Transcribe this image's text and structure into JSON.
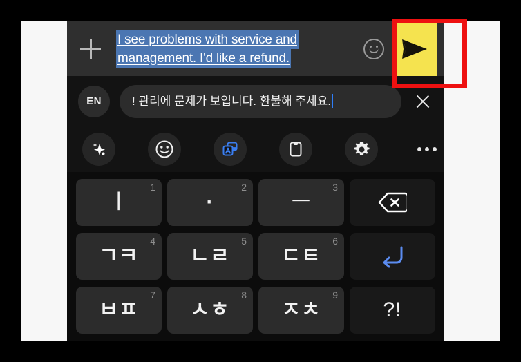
{
  "compose": {
    "add_icon": "plus-icon",
    "message_lines": [
      "I see problems with service and",
      "management. I'd like a refund."
    ],
    "message_full": "I see problems with service and management. I'd like a refund.",
    "selected": "true",
    "emoji_icon": "smiley-icon",
    "send_icon": "send-icon",
    "send_label": "Send",
    "send_highlight_color": "#f5e34f",
    "selection_color": "#4b76b2"
  },
  "annotation": {
    "shape": "rectangle",
    "color": "#ee1111",
    "target": "send-button"
  },
  "translate": {
    "language_badge": "EN",
    "source_text": "! 관리에 문제가 보입니다. 환불해 주세요.",
    "caret_color": "#2f7df6",
    "close_icon": "close-icon"
  },
  "toolbar": {
    "items": [
      {
        "name": "ai-sparkle-icon",
        "label": "AI suggestions",
        "active": "false"
      },
      {
        "name": "emoji-icon",
        "label": "Emoji",
        "active": "false"
      },
      {
        "name": "translate-icon",
        "label": "Translate",
        "active": "true"
      },
      {
        "name": "clipboard-icon",
        "label": "Clipboard",
        "active": "false"
      },
      {
        "name": "settings-gear-icon",
        "label": "Settings",
        "active": "false"
      },
      {
        "name": "more-options-icon",
        "label": "More options",
        "active": "false"
      }
    ],
    "active_color": "#3b7ef0"
  },
  "keyboard": {
    "layout": "cheonjiin",
    "rows": [
      [
        {
          "main": "ㅣ",
          "num": "1",
          "type": "char"
        },
        {
          "main": "·",
          "num": "2",
          "type": "char"
        },
        {
          "main": "ㅡ",
          "num": "3",
          "type": "char"
        },
        {
          "main": "",
          "num": "",
          "type": "backspace",
          "label": "Backspace"
        }
      ],
      [
        {
          "main": "ㄱㅋ",
          "num": "4",
          "type": "char"
        },
        {
          "main": "ㄴㄹ",
          "num": "5",
          "type": "char"
        },
        {
          "main": "ㄷㅌ",
          "num": "6",
          "type": "char"
        },
        {
          "main": "",
          "num": "",
          "type": "enter",
          "label": "Enter"
        }
      ],
      [
        {
          "main": "ㅂㅍ",
          "num": "7",
          "type": "char"
        },
        {
          "main": "ㅅㅎ",
          "num": "8",
          "type": "char"
        },
        {
          "main": "ㅈㅊ",
          "num": "9",
          "type": "char"
        },
        {
          "main": "?!",
          "num": "",
          "type": "punct"
        }
      ]
    ]
  }
}
